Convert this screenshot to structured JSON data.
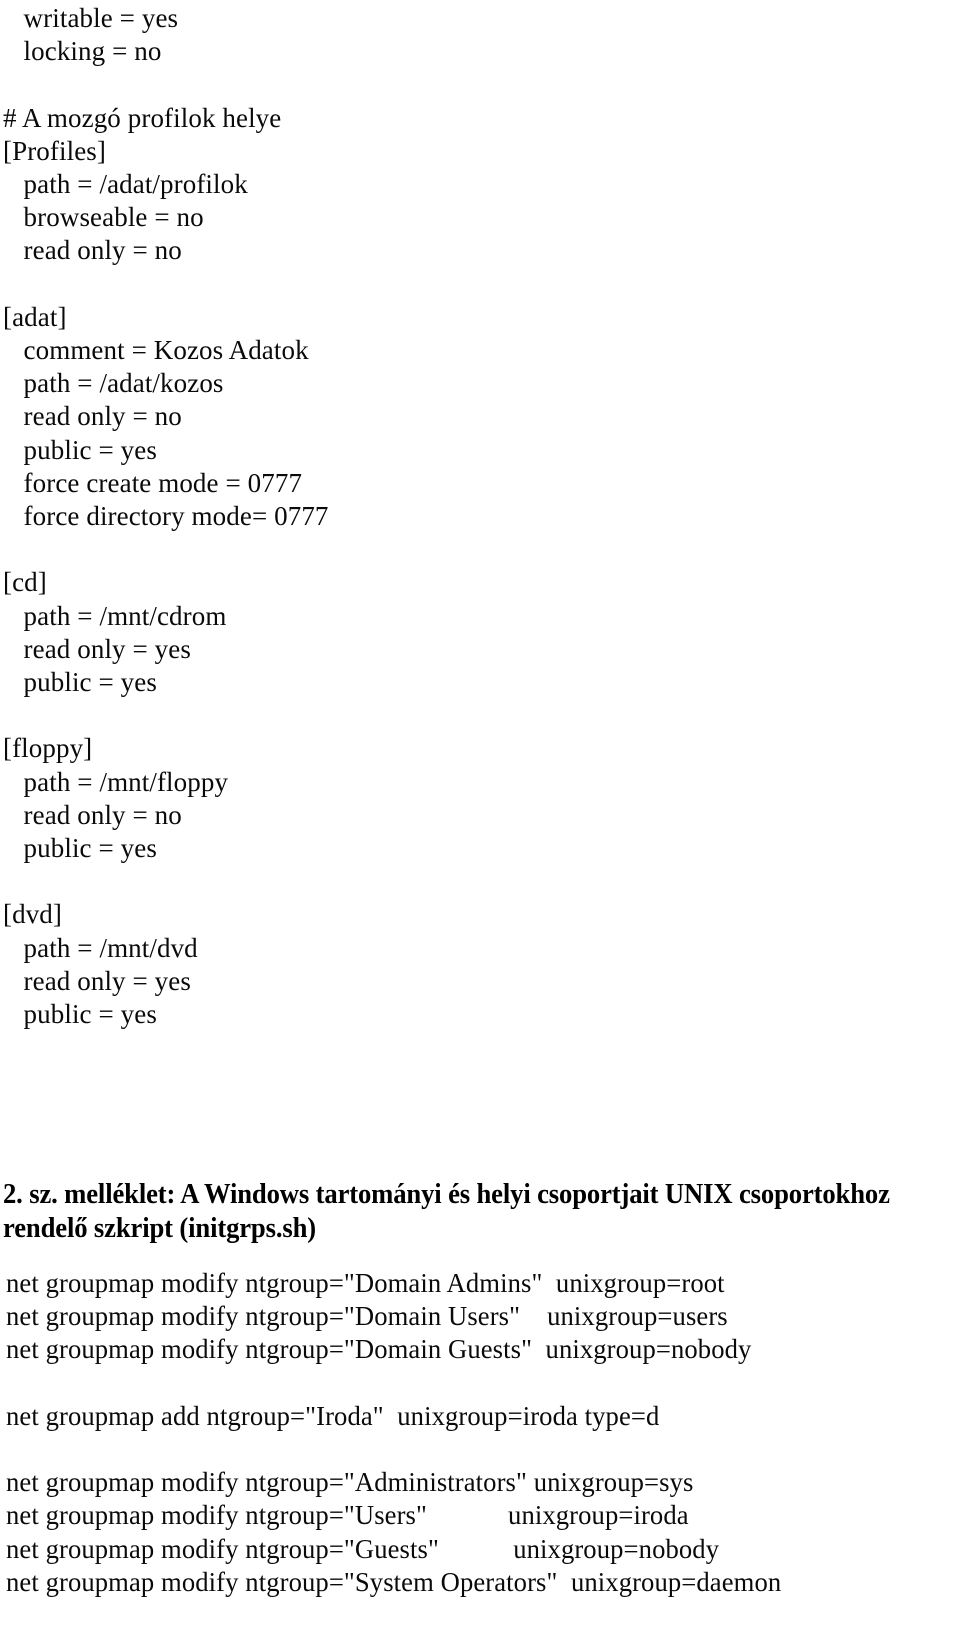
{
  "document": {
    "type": "scanned-document-page",
    "language": "hu",
    "background_color": "#ffffff",
    "text_color": "#000000"
  },
  "smb_conf_listing": {
    "name": "smb.conf share definitions",
    "lines": [
      "   writable = yes",
      "   locking = no",
      "",
      "# A mozgó profilok helye",
      "[Profiles]",
      "   path = /adat/profilok",
      "   browseable = no",
      "   read only = no",
      "",
      "[adat]",
      "   comment = Kozos Adatok",
      "   path = /adat/kozos",
      "   read only = no",
      "   public = yes",
      "   force create mode = 0777",
      "   force directory mode= 0777",
      "",
      "[cd]",
      "   path = /mnt/cdrom",
      "   read only = yes",
      "   public = yes",
      "",
      "[floppy]",
      "   path = /mnt/floppy",
      "   read only = no",
      "   public = yes",
      "",
      "[dvd]",
      "   path = /mnt/dvd",
      "   read only = yes",
      "   public = yes"
    ]
  },
  "appendix_heading": {
    "line1": "2. sz. melléklet: A Windows tartományi és helyi csoportjait UNIX csoportokhoz",
    "line2": "rendelő szkript (initgrps.sh)"
  },
  "initgrps_listing": {
    "name": "initgrps.sh script body",
    "lines": [
      "net groupmap modify ntgroup=\"Domain Admins\"  unixgroup=root",
      "net groupmap modify ntgroup=\"Domain Users\"    unixgroup=users",
      "net groupmap modify ntgroup=\"Domain Guests\"  unixgroup=nobody",
      "",
      "net groupmap add ntgroup=\"Iroda\"  unixgroup=iroda type=d",
      "",
      "net groupmap modify ntgroup=\"Administrators\" unixgroup=sys",
      "net groupmap modify ntgroup=\"Users\"            unixgroup=iroda",
      "net groupmap modify ntgroup=\"Guests\"           unixgroup=nobody",
      "net groupmap modify ntgroup=\"System Operators\"  unixgroup=daemon"
    ]
  }
}
